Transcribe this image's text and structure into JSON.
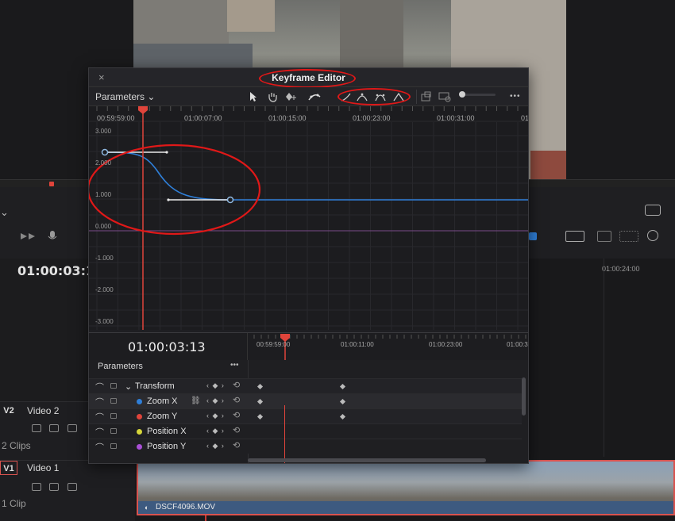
{
  "keyframe_editor": {
    "close_icon": "×",
    "title": "Keyframe Editor",
    "params_label": "Parameters",
    "params_chevron": "⌄",
    "timecodes_top": [
      "00:59:59:00",
      "01:00:07:00",
      "01:00:15:00",
      "01:00:23:00",
      "01:00:31:00",
      "01"
    ],
    "y_labels": [
      "3.000",
      "2.000",
      "1.000",
      "0.000",
      "-1.000",
      "-2.000",
      "-3.000"
    ],
    "current_timecode": "01:00:03:13",
    "timecodes_bottom": [
      "00:59:59:00",
      "01:00:11:00",
      "01:00:23:00",
      "01:00:3"
    ],
    "parameters_header": "Parameters",
    "more_icon": "•••",
    "rows": [
      {
        "label": "Transform",
        "chevron": "⌄",
        "dot": ""
      },
      {
        "label": "Zoom X",
        "dot": "#2f7fd8"
      },
      {
        "label": "Zoom Y",
        "dot": "#e0443b"
      },
      {
        "label": "Position X",
        "dot": "#d6d63a"
      },
      {
        "label": "Position Y",
        "dot": "#a94fd6"
      }
    ],
    "row_controls": "‹ ◆ ›",
    "reset_icon": "⟲",
    "link_icon": "🔗"
  },
  "background": {
    "timecode": "01:00:03:1",
    "ruler_label": "01:00:24:00",
    "tracks": [
      {
        "tag": "V2",
        "name": "Video 2",
        "clips": "2 Clips"
      },
      {
        "tag": "V1",
        "name": "Video 1",
        "clips": "1 Clip"
      }
    ],
    "clip_name": "DSCF4096.MOV",
    "chevron": "⌄"
  },
  "colors": {
    "curve": "#2f7fd8",
    "playhead": "#e0443b",
    "annotation": "#e01818"
  },
  "curve_data": {
    "keyframes": [
      {
        "time": "00:59:59:00",
        "value": 2.4
      },
      {
        "time": "01:00:06:00",
        "value": 0.95
      }
    ]
  }
}
